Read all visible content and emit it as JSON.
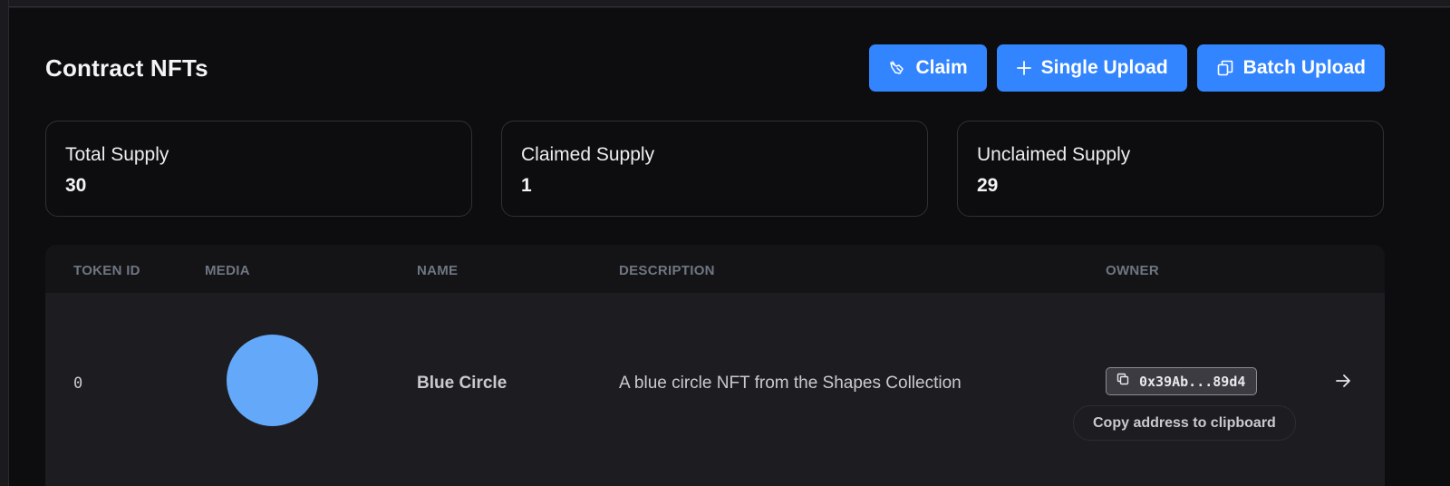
{
  "header": {
    "title": "Contract NFTs",
    "buttons": [
      {
        "label": "Claim",
        "icon": "hand-pointer-icon"
      },
      {
        "label": "Single Upload",
        "icon": "plus-icon"
      },
      {
        "label": "Batch Upload",
        "icon": "copy-stack-icon"
      }
    ]
  },
  "stats": [
    {
      "label": "Total Supply",
      "value": "30"
    },
    {
      "label": "Claimed Supply",
      "value": "1"
    },
    {
      "label": "Unclaimed Supply",
      "value": "29"
    }
  ],
  "table": {
    "columns": [
      "TOKEN ID",
      "MEDIA",
      "NAME",
      "DESCRIPTION",
      "OWNER"
    ],
    "rows": [
      {
        "token_id": "0",
        "media": {
          "shape": "circle",
          "color": "#64a8fa"
        },
        "name": "Blue Circle",
        "description": "A blue circle NFT from the Shapes Collection",
        "owner": "0x39Ab...89d4",
        "owner_icon": "copy-icon",
        "tooltip": "Copy address to clipboard",
        "action_icon": "arrow-right-icon"
      }
    ]
  },
  "colors": {
    "accent": "#3385ff",
    "background": "#0d0d0f",
    "row_background": "#1d1d21"
  }
}
